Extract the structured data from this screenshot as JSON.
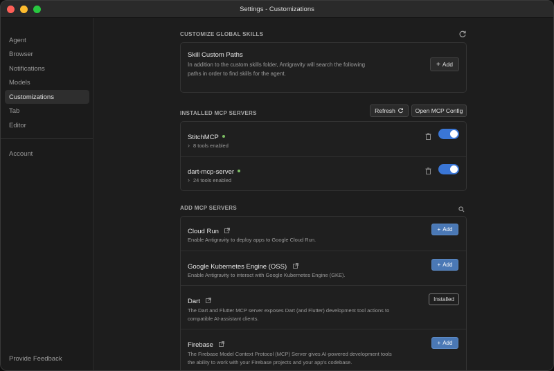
{
  "window": {
    "title": "Settings - Customizations"
  },
  "sidebar": {
    "items": [
      {
        "label": "Agent"
      },
      {
        "label": "Browser"
      },
      {
        "label": "Notifications"
      },
      {
        "label": "Models"
      },
      {
        "label": "Customizations",
        "active": true
      },
      {
        "label": "Tab"
      },
      {
        "label": "Editor"
      }
    ],
    "account_label": "Account",
    "feedback_label": "Provide Feedback"
  },
  "global_skills": {
    "heading": "CUSTOMIZE GLOBAL SKILLS",
    "refresh_icon": "refresh-icon",
    "card_title": "Skill Custom Paths",
    "card_desc_line1": "In addition to the custom skills folder, Antigravity will search the following",
    "card_desc_line2": "paths in order to find skills for the agent.",
    "add_label": "Add"
  },
  "installed": {
    "heading": "INSTALLED MCP SERVERS",
    "refresh_label": "Refresh",
    "open_config_label": "Open MCP Config",
    "servers": [
      {
        "name": "StitchMCP",
        "tools": "8 tools enabled",
        "enabled": true,
        "status_color": "#7cbf63"
      },
      {
        "name": "dart-mcp-server",
        "tools": "24 tools enabled",
        "enabled": true,
        "status_color": "#7cbf63"
      }
    ]
  },
  "add_servers": {
    "heading": "ADD MCP SERVERS",
    "items": [
      {
        "name": "Cloud Run",
        "desc1": "Enable Antigravity to deploy apps to Google Cloud Run.",
        "desc2": "",
        "action": "Add"
      },
      {
        "name": "Google Kubernetes Engine (OSS)",
        "desc1": "Enable Antigravity to interact with Google Kubernetes Engine (GKE).",
        "desc2": "",
        "action": "Add"
      },
      {
        "name": "Dart",
        "desc1": "The Dart and Flutter MCP server exposes Dart (and Flutter) development tool actions to",
        "desc2": "compatible AI-assistant clients.",
        "action": "Installed"
      },
      {
        "name": "Firebase",
        "desc1": "The Firebase Model Context Protocol (MCP) Server gives AI-powered development tools",
        "desc2": "the ability to work with your Firebase projects and your app's codebase.",
        "action": "Add"
      }
    ]
  },
  "colors": {
    "accent": "#3a76d6",
    "button_blue": "#4a78b5",
    "status_green": "#7cbf63"
  }
}
